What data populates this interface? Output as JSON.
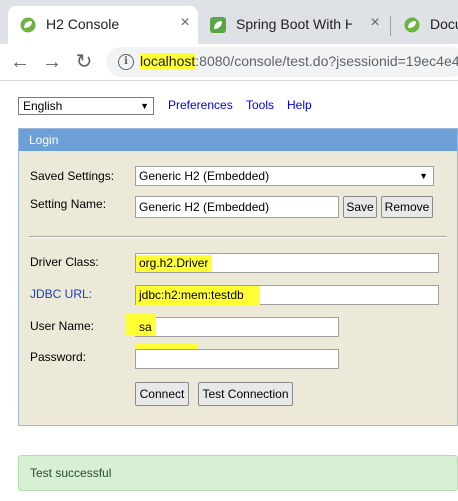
{
  "browser": {
    "tabs": [
      {
        "title": "H2 Console",
        "icon": "h2-leaf-icon",
        "active": true
      },
      {
        "title": "Spring Boot With H",
        "icon": "spring-leaf-icon",
        "active": false
      },
      {
        "title": "Docu",
        "icon": "h2-leaf-icon",
        "active": false
      }
    ],
    "url": {
      "host": "localhost",
      "rest": ":8080/console/test.do?jsessionid=19ec4e4"
    }
  },
  "topbar": {
    "language": "English",
    "links": [
      "Preferences",
      "Tools",
      "Help"
    ]
  },
  "login": {
    "title": "Login",
    "saved_settings_label": "Saved Settings:",
    "saved_settings_value": "Generic H2 (Embedded)",
    "setting_name_label": "Setting Name:",
    "setting_name_value": "Generic H2 (Embedded)",
    "save_label": "Save",
    "remove_label": "Remove",
    "driver_class_label": "Driver Class:",
    "driver_class_value": "org.h2.Driver",
    "jdbc_url_label": "JDBC URL:",
    "jdbc_url_value": "jdbc:h2:mem:testdb",
    "user_name_label": "User Name:",
    "user_name_value": "sa",
    "password_label": "Password:",
    "password_value": "",
    "connect_label": "Connect",
    "test_connection_label": "Test Connection"
  },
  "status": {
    "message": "Test successful"
  },
  "colors": {
    "highlight": "#ffff33",
    "panel_header": "#6ea0d8",
    "panel_bg": "#ece9d8",
    "success_bg": "#d7efd2",
    "link": "#0000ee"
  }
}
